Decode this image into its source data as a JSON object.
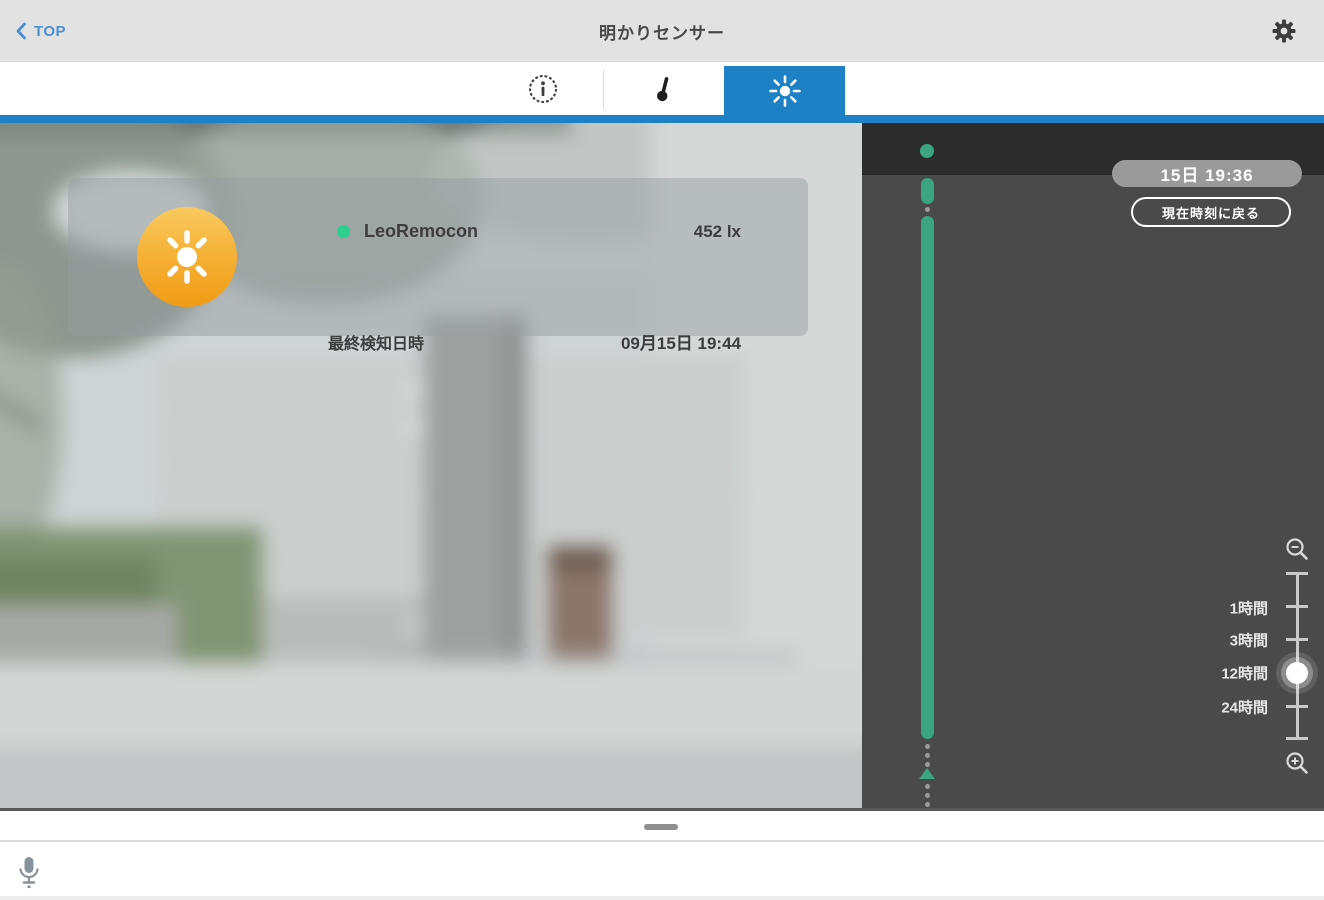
{
  "topbar": {
    "back_label": "TOP",
    "title": "明かりセンサー"
  },
  "tabs": {
    "items": [
      {
        "id": "info",
        "icon": "info-circle-icon",
        "active": false
      },
      {
        "id": "temperature",
        "icon": "thermometer-icon",
        "active": false
      },
      {
        "id": "brightness",
        "icon": "sun-icon",
        "active": true
      }
    ]
  },
  "sensor_card": {
    "icon": "sun-badge",
    "device_name": "LeoRemocon",
    "illuminance": "452 lx",
    "last_detected_label": "最終検知日時",
    "last_detected_datetime": "09月15日 19:44"
  },
  "timeline_panel": {
    "timestamp_badge": "15日 19:36",
    "back_to_now_button": "現在時刻に戻る",
    "zoom_scale_labels": [
      "1時間",
      "3時間",
      "12時間",
      "24時間"
    ],
    "selected_scale": "12時間",
    "state": "continuous green activity bar with current-position marker and upward arrow below"
  },
  "footer": {
    "icons": [
      "drag-handle",
      "microphone-icon"
    ]
  },
  "colors": {
    "accent_blue": "#1E81C5",
    "link_blue": "#4D90D2",
    "timeline_green": "#3AA580",
    "status_green": "#2FCF92",
    "panel_dark": "#4A4A4A",
    "panel_darker": "#2C2C2C",
    "badge_gray": "#9A9A9A",
    "sun_orange_top": "#F9CA5E",
    "sun_orange_bottom": "#F09C15",
    "topbar_gray": "#E2E2E2"
  }
}
